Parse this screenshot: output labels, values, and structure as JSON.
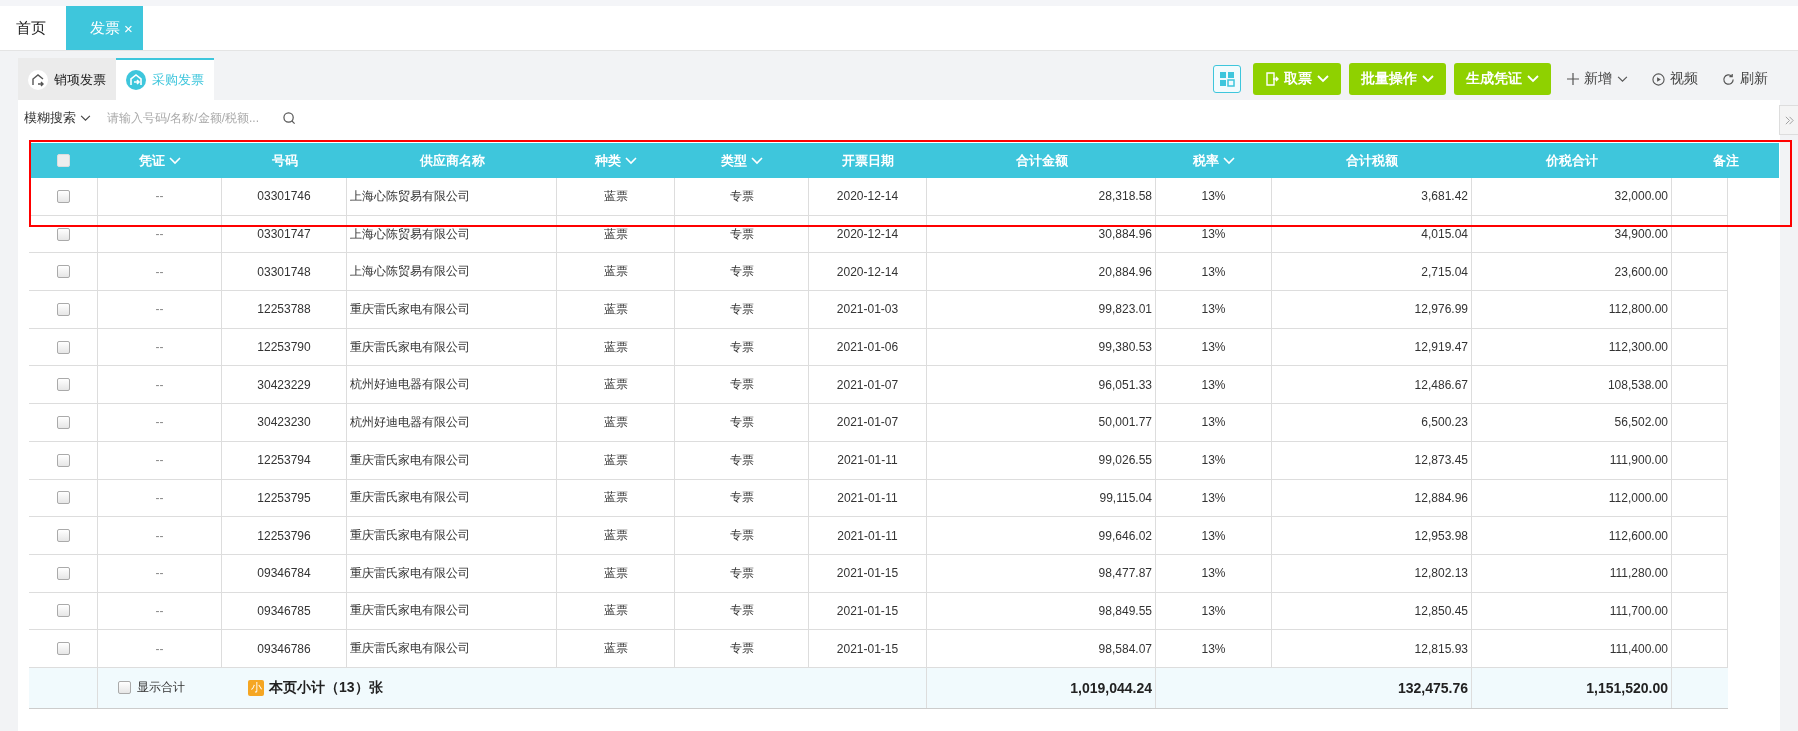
{
  "tabs": [
    {
      "label": "首页",
      "selected": false
    },
    {
      "label": "发票",
      "selected": true,
      "close": "×"
    }
  ],
  "subtabs": [
    {
      "label": "销项发票",
      "selected": false
    },
    {
      "label": "采购发票",
      "selected": true
    }
  ],
  "toolbar": [
    {
      "kind": "grid"
    },
    {
      "kind": "fetch",
      "label": "取票",
      "dropdown": true
    },
    {
      "kind": "primary",
      "label": "批量操作",
      "dropdown": true
    },
    {
      "kind": "primary",
      "label": "生成凭证",
      "dropdown": true
    },
    {
      "kind": "add",
      "label": "新增",
      "dropdown": true
    },
    {
      "kind": "video",
      "label": "视频",
      "dropdown": false
    },
    {
      "kind": "refresh",
      "label": "刷新",
      "dropdown": false
    }
  ],
  "search": {
    "mode": "模糊搜索",
    "placeholder": "请输入号码/名称/金额/税额..."
  },
  "table": {
    "select_all_checked": false,
    "columns": [
      {
        "label": "凭证",
        "dropdown": true
      },
      {
        "label": "号码",
        "dropdown": false
      },
      {
        "label": "供应商名称",
        "dropdown": false
      },
      {
        "label": "种类",
        "dropdown": true
      },
      {
        "label": "类型",
        "dropdown": true
      },
      {
        "label": "开票日期",
        "dropdown": false
      },
      {
        "label": "合计金额",
        "dropdown": false
      },
      {
        "label": "税率",
        "dropdown": true
      },
      {
        "label": "合计税额",
        "dropdown": false
      },
      {
        "label": "价税合计",
        "dropdown": false
      },
      {
        "label": "备注",
        "dropdown": false
      }
    ],
    "rows": [
      {
        "checked": false,
        "voucher": "--",
        "number": "03301746",
        "supplier": "上海心陈贸易有限公司",
        "category": "蓝票",
        "type": "专票",
        "date": "2020-12-14",
        "amount": "28,318.58",
        "rate": "13%",
        "tax": "3,681.42",
        "total": "32,000.00"
      },
      {
        "checked": false,
        "voucher": "--",
        "number": "03301747",
        "supplier": "上海心陈贸易有限公司",
        "category": "蓝票",
        "type": "专票",
        "date": "2020-12-14",
        "amount": "30,884.96",
        "rate": "13%",
        "tax": "4,015.04",
        "total": "34,900.00"
      },
      {
        "checked": false,
        "voucher": "--",
        "number": "03301748",
        "supplier": "上海心陈贸易有限公司",
        "category": "蓝票",
        "type": "专票",
        "date": "2020-12-14",
        "amount": "20,884.96",
        "rate": "13%",
        "tax": "2,715.04",
        "total": "23,600.00"
      },
      {
        "checked": false,
        "voucher": "--",
        "number": "12253788",
        "supplier": "重庆雷氏家电有限公司",
        "category": "蓝票",
        "type": "专票",
        "date": "2021-01-03",
        "amount": "99,823.01",
        "rate": "13%",
        "tax": "12,976.99",
        "total": "112,800.00"
      },
      {
        "checked": false,
        "voucher": "--",
        "number": "12253790",
        "supplier": "重庆雷氏家电有限公司",
        "category": "蓝票",
        "type": "专票",
        "date": "2021-01-06",
        "amount": "99,380.53",
        "rate": "13%",
        "tax": "12,919.47",
        "total": "112,300.00"
      },
      {
        "checked": false,
        "voucher": "--",
        "number": "30423229",
        "supplier": "杭州好迪电器有限公司",
        "category": "蓝票",
        "type": "专票",
        "date": "2021-01-07",
        "amount": "96,051.33",
        "rate": "13%",
        "tax": "12,486.67",
        "total": "108,538.00"
      },
      {
        "checked": false,
        "voucher": "--",
        "number": "30423230",
        "supplier": "杭州好迪电器有限公司",
        "category": "蓝票",
        "type": "专票",
        "date": "2021-01-07",
        "amount": "50,001.77",
        "rate": "13%",
        "tax": "6,500.23",
        "total": "56,502.00"
      },
      {
        "checked": false,
        "voucher": "--",
        "number": "12253794",
        "supplier": "重庆雷氏家电有限公司",
        "category": "蓝票",
        "type": "专票",
        "date": "2021-01-11",
        "amount": "99,026.55",
        "rate": "13%",
        "tax": "12,873.45",
        "total": "111,900.00"
      },
      {
        "checked": false,
        "voucher": "--",
        "number": "12253795",
        "supplier": "重庆雷氏家电有限公司",
        "category": "蓝票",
        "type": "专票",
        "date": "2021-01-11",
        "amount": "99,115.04",
        "rate": "13%",
        "tax": "12,884.96",
        "total": "112,000.00"
      },
      {
        "checked": false,
        "voucher": "--",
        "number": "12253796",
        "supplier": "重庆雷氏家电有限公司",
        "category": "蓝票",
        "type": "专票",
        "date": "2021-01-11",
        "amount": "99,646.02",
        "rate": "13%",
        "tax": "12,953.98",
        "total": "112,600.00"
      },
      {
        "checked": false,
        "voucher": "--",
        "number": "09346784",
        "supplier": "重庆雷氏家电有限公司",
        "category": "蓝票",
        "type": "专票",
        "date": "2021-01-15",
        "amount": "98,477.87",
        "rate": "13%",
        "tax": "12,802.13",
        "total": "111,280.00"
      },
      {
        "checked": false,
        "voucher": "--",
        "number": "09346785",
        "supplier": "重庆雷氏家电有限公司",
        "category": "蓝票",
        "type": "专票",
        "date": "2021-01-15",
        "amount": "98,849.55",
        "rate": "13%",
        "tax": "12,850.45",
        "total": "111,700.00"
      },
      {
        "checked": false,
        "voucher": "--",
        "number": "09346786",
        "supplier": "重庆雷氏家电有限公司",
        "category": "蓝票",
        "type": "专票",
        "date": "2021-01-15",
        "amount": "98,584.07",
        "rate": "13%",
        "tax": "12,815.93",
        "total": "111,400.00"
      }
    ],
    "footer": {
      "show_total_label": "显示合计",
      "show_total_checked": false,
      "badge": "小",
      "subtotal": "本页小计（13）张",
      "amount": "1,019,044.24",
      "tax": "132,475.76",
      "total": "1,151,520.00"
    }
  }
}
